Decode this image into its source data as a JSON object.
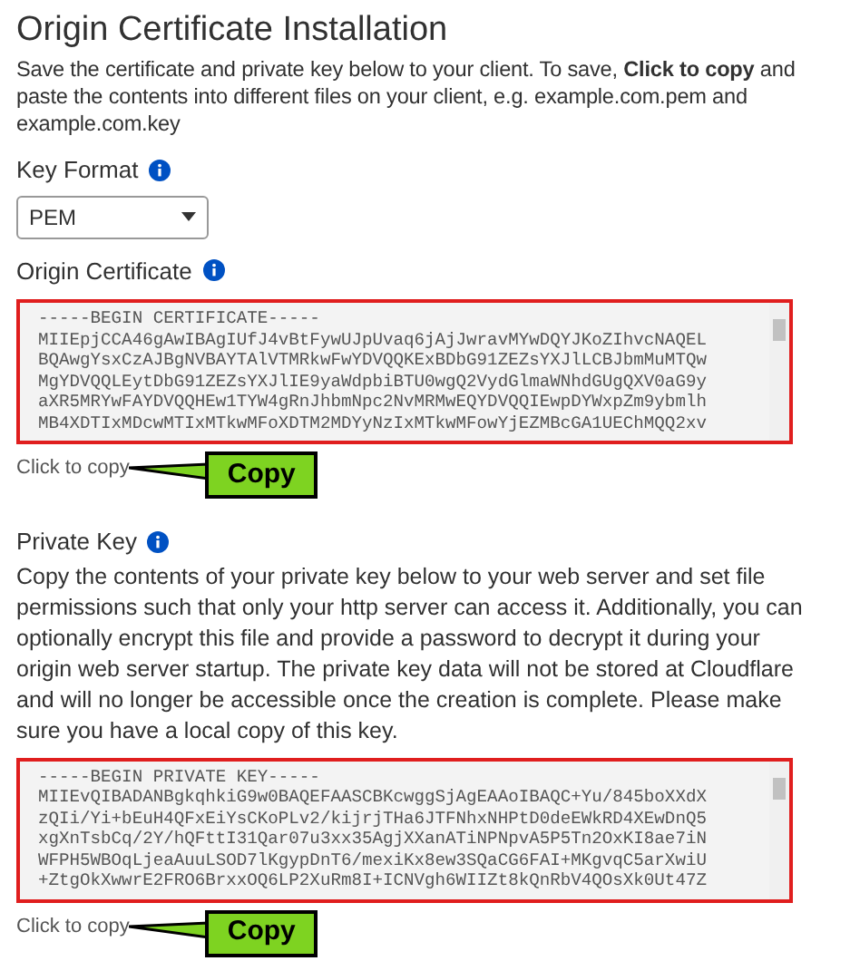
{
  "title": "Origin Certificate Installation",
  "intro": "Save the certificate and private key below to your client. To save, **Click to copy** and paste the contents into different files on your client, e.g. example.com.pem and example.com.key",
  "key_format": {
    "label": "Key Format",
    "value": "PEM"
  },
  "sections": [
    {
      "label": "Origin Certificate",
      "lines": [
        "-----BEGIN CERTIFICATE-----",
        "MIIEpjCCA46gAwIBAgIUfJ4vBtFywUJpUvaq6jAjJwravMYwDQYJKoZIhvcNAQEL",
        "BQAwgYsxCzAJBgNVBAYTAlVTMRkwFwYDVQQKExBDbG91ZEZsYXJlLCBJbmMuMTQw",
        "MgYDVQQLEytDbG91ZEZsYXJlIE9yaWdpbiBTU0wgQ2VydGlmaWNhdGUgQXV0aG9y",
        "aXR5MRYwFAYDVQQHEw1TYW4gRnJhbmNpc2NvMRMwEQYDVQQIEwpDYWxpZm9ybmlh",
        "MB4XDTIxMDcwMTIxMTkwMFoXDTM2MDYyNzIxMTkwMFowYjEZMBcGA1UEChMQQ2xv"
      ],
      "hint": "Click to copy",
      "callout": "Copy"
    },
    {
      "label": "Private Key",
      "description": "Copy the contents of your private key below to your web server and set file permissions such that only your http server can access it. Additionally, you can optionally encrypt this file and provide a password to decrypt it during your origin web server startup. The private key data will not be stored at Cloudflare and will no longer be accessible once the creation is complete. Please make sure you have a local copy of this key.",
      "lines": [
        "-----BEGIN PRIVATE KEY-----",
        "MIIEvQIBADANBgkqhkiG9w0BAQEFAASCBKcwggSjAgEAAoIBAQC+Yu/845boXXdX",
        "zQIi/Yi+bEuH4QFxEiYsCKoPLv2/kijrjTHa6JTFNhxNHPtD0deEWkRD4XEwDnQ5",
        "xgXnTsbCq/2Y/hQFttI31Qar07u3xx35AgjXXanATiNPNpvA5P5Tn2OxKI8ae7iN",
        "WFPH5WBOqLjeaAuuLSOD7lKgypDnT6/mexiKx8ew3SQaCG6FAI+MKgvqC5arXwiU",
        "+ZtgOkXwwrE2FRO6BrxxOQ6LP2XuRm8I+ICNVgh6WIIZt8kQnRbV4QOsXk0Ut47Z"
      ],
      "hint": "Click to copy",
      "callout": "Copy"
    }
  ]
}
